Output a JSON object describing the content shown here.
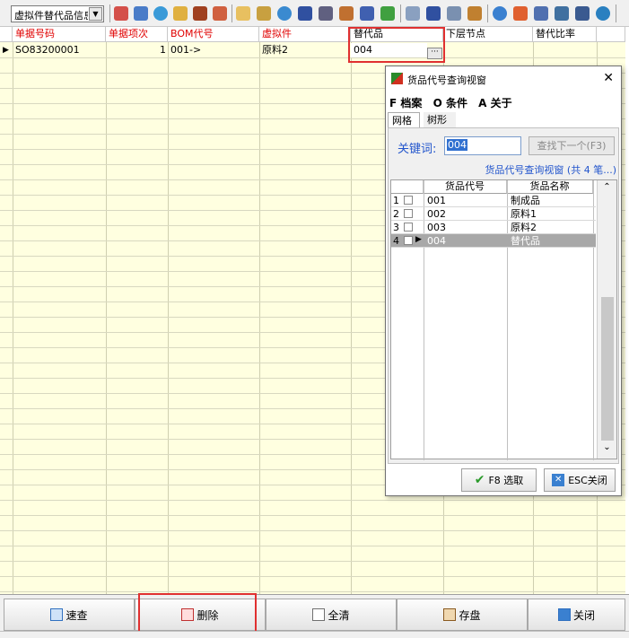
{
  "toolbar": {
    "dropdown_value": "虚拟件替代品信息",
    "icons": [
      "add-icon",
      "save-icon",
      "refresh-icon",
      "filter-icon",
      "box-icon",
      "user-icon",
      "folder-icon",
      "gift-icon",
      "help-icon",
      "grid-icon",
      "arrow-icon",
      "chart-icon",
      "bookmark-icon",
      "money-icon",
      "doc-icon",
      "list-icon",
      "copy-icon",
      "db-icon",
      "check-icon",
      "flag-icon",
      "page-icon",
      "monitor-icon",
      "home-icon",
      "refresh2-icon"
    ]
  },
  "grid": {
    "headers": [
      {
        "label": "单据号码",
        "red": true
      },
      {
        "label": "单据项次",
        "red": true
      },
      {
        "label": "BOM代号",
        "red": true
      },
      {
        "label": "虚拟件",
        "red": true
      },
      {
        "label": "替代品",
        "red": false
      },
      {
        "label": "下层节点",
        "red": false
      },
      {
        "label": "替代比率",
        "red": false
      }
    ],
    "row": {
      "doc_no": "SO83200001",
      "item_no": "1",
      "bom": "001->",
      "virtual": "原料2",
      "substitute": "004",
      "ellipsis": "···"
    }
  },
  "dialog": {
    "title": "货品代号查询视窗",
    "close": "✕",
    "menu": [
      "F 档案",
      "O 条件",
      "A 关于"
    ],
    "tabs": [
      "网格",
      "树形"
    ],
    "keyword_label": "关键词:",
    "keyword_value": "004",
    "find_next": "查找下一个(F3)",
    "caption": "货品代号查询视窗 (共 4 笔...)",
    "columns": [
      "货品代号",
      "货品名称"
    ],
    "rows": [
      {
        "num": "1",
        "code": "001",
        "name": "制成品"
      },
      {
        "num": "2",
        "code": "002",
        "name": "原料1"
      },
      {
        "num": "3",
        "code": "003",
        "name": "原料2"
      },
      {
        "num": "4",
        "code": "004",
        "name": "替代品"
      }
    ],
    "ok_label": "F8 选取",
    "cancel_label": "ESC关闭"
  },
  "bottom": {
    "quick": "速查",
    "delete": "删除",
    "clear": "全清",
    "save": "存盘",
    "close": "关闭"
  }
}
